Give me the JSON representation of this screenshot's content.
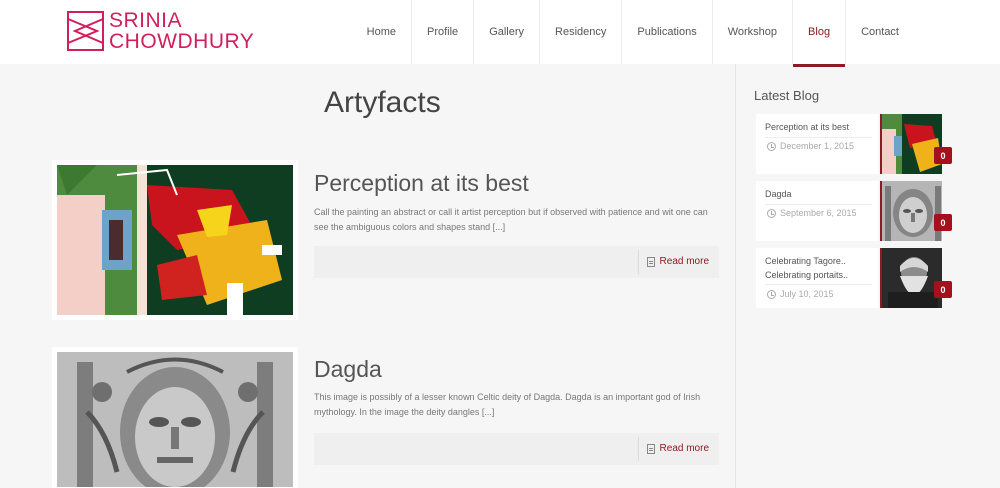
{
  "logo": {
    "line1": "SRINIA",
    "line2": "CHOWDHURY",
    "color": "#d11f5c"
  },
  "nav": [
    {
      "label": "Home",
      "active": false
    },
    {
      "label": "Profile",
      "active": false
    },
    {
      "label": "Gallery",
      "active": false
    },
    {
      "label": "Residency",
      "active": false
    },
    {
      "label": "Publications",
      "active": false
    },
    {
      "label": "Workshop",
      "active": false
    },
    {
      "label": "Blog",
      "active": true
    },
    {
      "label": "Contact",
      "active": false
    }
  ],
  "page_title": "Artyfacts",
  "posts": [
    {
      "title": "Perception at its best",
      "excerpt": "Call the painting an abstract or call it artist perception but if observed with patience and wit one can see the ambiguous colors and shapes stand [...]",
      "read_more": "Read more"
    },
    {
      "title": "Dagda",
      "excerpt": "This image is possibly of a lesser known Celtic deity of Dagda. Dagda is an important god of Irish mythology. In the image the deity dangles [...]",
      "read_more": "Read more"
    }
  ],
  "sidebar": {
    "title": "Latest Blog",
    "items": [
      {
        "title": "Perception at its best",
        "date": "December 1, 2015",
        "comments": "0"
      },
      {
        "title": "Dagda",
        "date": "September 6, 2015",
        "comments": "0"
      },
      {
        "title": "Celebrating Tagore.. Celebrating portaits..",
        "date": "July 10, 2015",
        "comments": "0"
      }
    ]
  },
  "colors": {
    "accent": "#8d1b25",
    "badge": "#a3121c",
    "background": "#f6f6f6"
  }
}
